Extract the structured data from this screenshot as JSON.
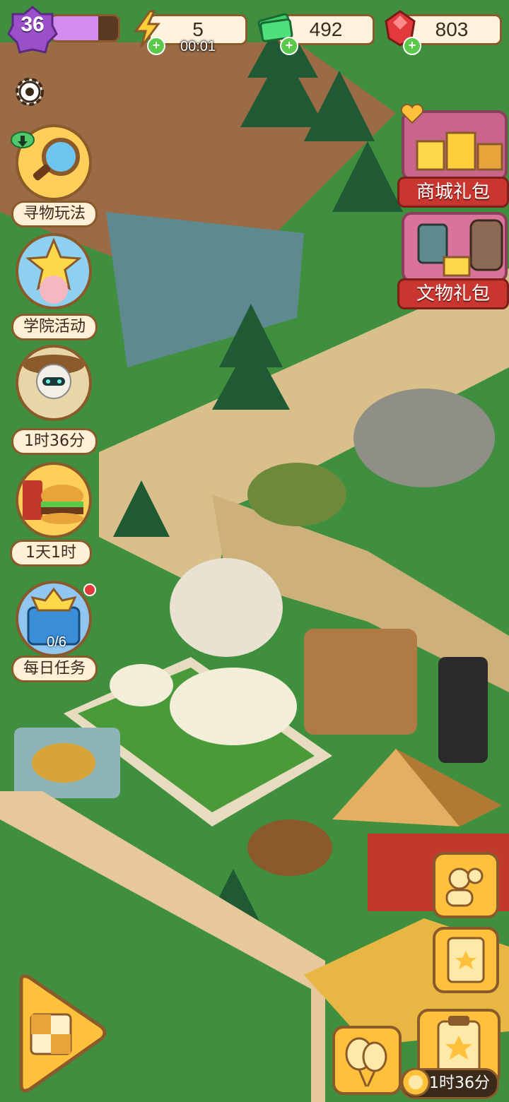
{
  "hud": {
    "level": "36",
    "xp_fraction": 0.7,
    "energy": "5",
    "energy_timer": "00:01",
    "cash": "492",
    "gems": "803"
  },
  "side_menu": {
    "items": [
      {
        "label": "寻物玩法",
        "icon": "magnifier-icon"
      },
      {
        "label": "学院活动",
        "icon": "star-character-icon"
      },
      {
        "label": "1时36分",
        "icon": "mummy-explorer-icon"
      },
      {
        "label": "1天1时",
        "icon": "burger-soda-icon"
      },
      {
        "label": "每日任务",
        "icon": "daily-task-box-icon",
        "progress": "0/6"
      }
    ]
  },
  "promos": {
    "shop_pack": "商城礼包",
    "relic_pack": "文物礼包"
  },
  "bottom": {
    "timer": "1时36分"
  },
  "colors": {
    "grass": "#3f8f3e",
    "path": "#d9c08a",
    "accent_gold": "#ffc13b",
    "border_brown": "#8a5a2b",
    "red_banner": "#c8362f"
  }
}
